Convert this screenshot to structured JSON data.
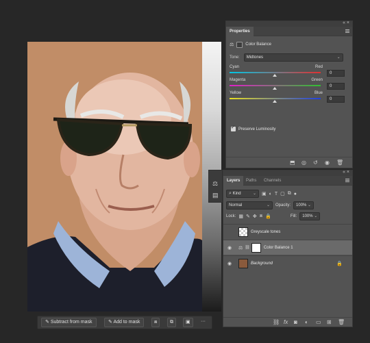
{
  "properties": {
    "tab_label": "Properties",
    "adjustment_name": "Color Balance",
    "tone_label": "Tone:",
    "tone_value": "Midtones",
    "sliders": [
      {
        "left": "Cyan",
        "right": "Red",
        "value": "0",
        "from": "#00c8e6",
        "to": "#e23030"
      },
      {
        "left": "Magenta",
        "right": "Green",
        "value": "0",
        "from": "#e020c8",
        "to": "#30c030"
      },
      {
        "left": "Yellow",
        "right": "Blue",
        "value": "0",
        "from": "#e8e020",
        "to": "#2040e0"
      }
    ],
    "preserve_luminosity_label": "Preserve Luminosity",
    "preserve_luminosity_checked": true
  },
  "layers_panel": {
    "tabs": [
      "Layers",
      "Paths",
      "Channels"
    ],
    "filter_kind": "Kind",
    "blend_mode": "Normal",
    "opacity_label": "Opacity:",
    "opacity_value": "100%",
    "lock_label": "Lock:",
    "fill_label": "Fill:",
    "fill_value": "100%",
    "layers": [
      {
        "name": "Greyscale tones",
        "selected": false,
        "visible": false
      },
      {
        "name": "Color Balance 1",
        "selected": true,
        "visible": true
      },
      {
        "name": "Background",
        "selected": false,
        "visible": true,
        "locked": true
      }
    ]
  },
  "mask_toolbar": {
    "subtract_label": "Subtract from mask",
    "add_label": "Add to mask",
    "more_label": "···"
  },
  "colors": {
    "panel_bg": "#535353",
    "canvas_bg": "#272727",
    "selected_layer": "#6a6a6a"
  }
}
